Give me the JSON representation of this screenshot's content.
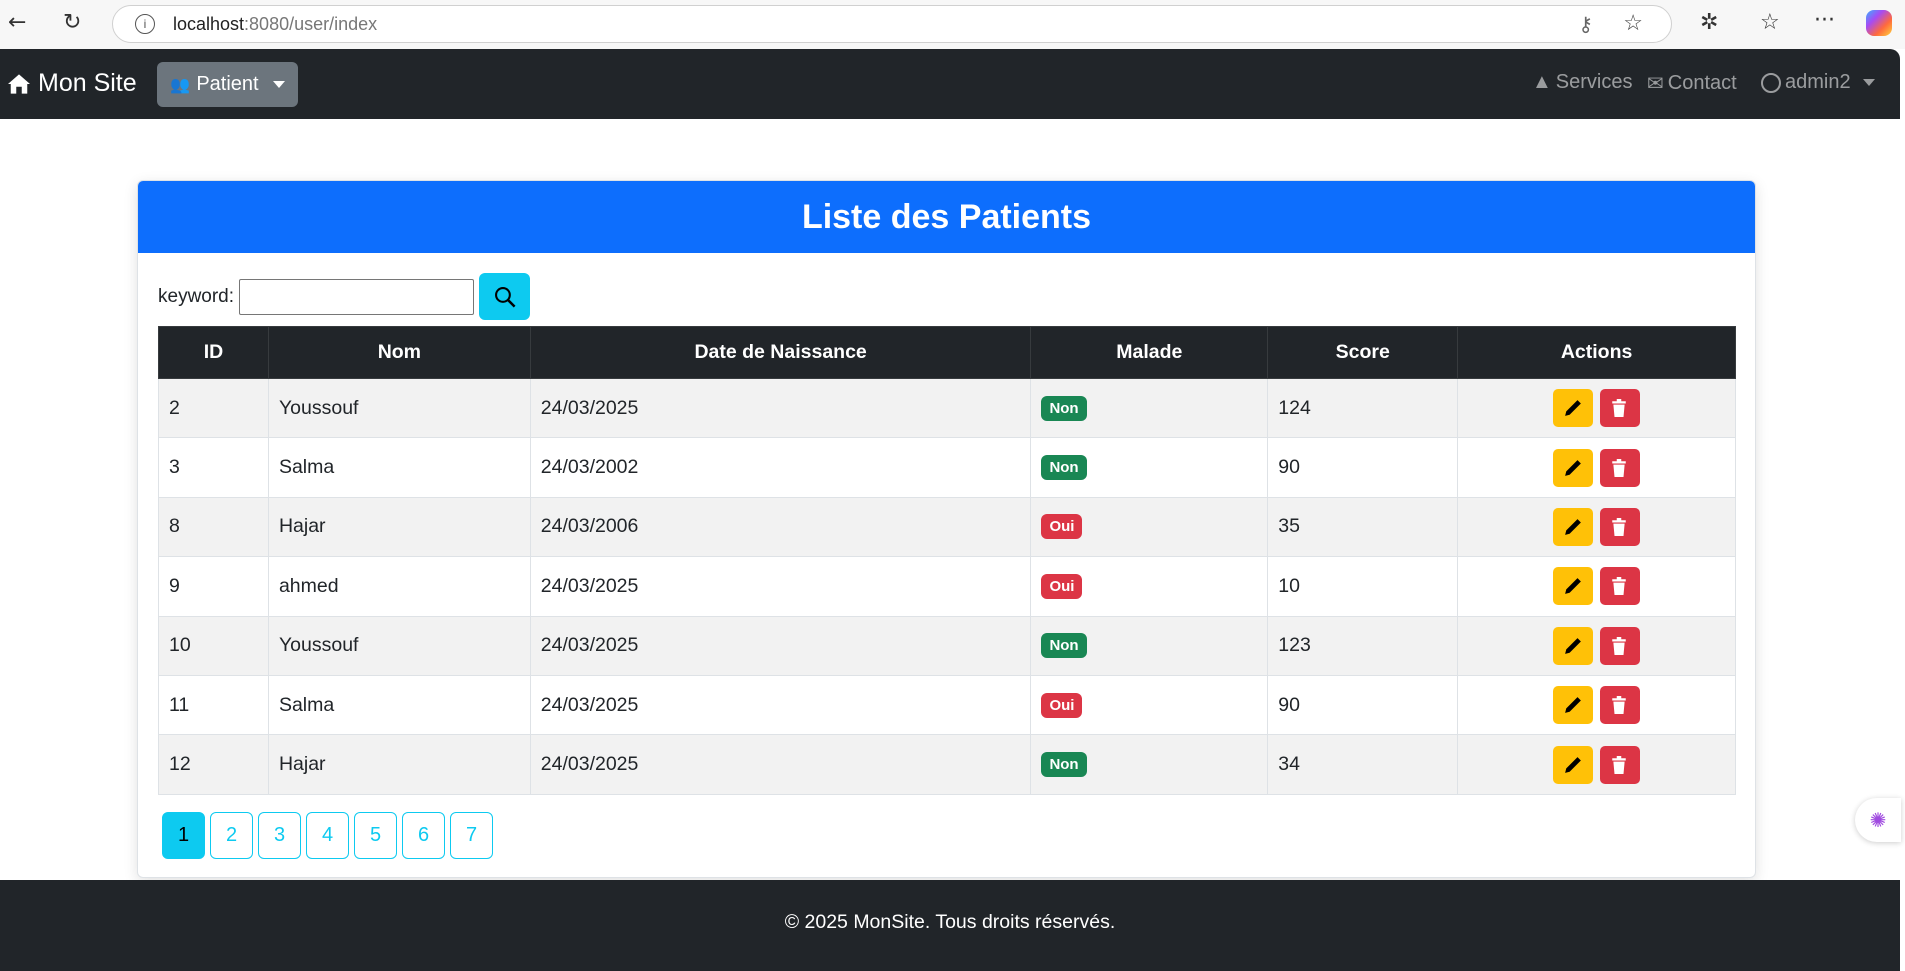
{
  "browser": {
    "url_host": "localhost",
    "url_rest": ":8080/user/index"
  },
  "navbar": {
    "brand": "Mon Site",
    "patient_menu": "Patient",
    "services": "Services",
    "contact": "Contact",
    "user": "admin2"
  },
  "card": {
    "title": "Liste des Patients"
  },
  "search": {
    "label": "keyword:",
    "value": "",
    "placeholder": ""
  },
  "table": {
    "headers": [
      "ID",
      "Nom",
      "Date de Naissance",
      "Malade",
      "Score",
      "Actions"
    ],
    "rows": [
      {
        "id": "2",
        "nom": "Youssouf",
        "date": "24/03/2025",
        "malade": "Non",
        "score": "124"
      },
      {
        "id": "3",
        "nom": "Salma",
        "date": "24/03/2002",
        "malade": "Non",
        "score": "90"
      },
      {
        "id": "8",
        "nom": "Hajar",
        "date": "24/03/2006",
        "malade": "Oui",
        "score": "35"
      },
      {
        "id": "9",
        "nom": "ahmed",
        "date": "24/03/2025",
        "malade": "Oui",
        "score": "10"
      },
      {
        "id": "10",
        "nom": "Youssouf",
        "date": "24/03/2025",
        "malade": "Non",
        "score": "123"
      },
      {
        "id": "11",
        "nom": "Salma",
        "date": "24/03/2025",
        "malade": "Oui",
        "score": "90"
      },
      {
        "id": "12",
        "nom": "Hajar",
        "date": "24/03/2025",
        "malade": "Non",
        "score": "34"
      }
    ]
  },
  "pagination": {
    "pages": [
      "1",
      "2",
      "3",
      "4",
      "5",
      "6",
      "7"
    ],
    "current": "1"
  },
  "footer": {
    "text": "© 2025 MonSite. Tous droits réservés."
  },
  "colors": {
    "primary": "#0d6efd",
    "info": "#0dcaf0",
    "success": "#198754",
    "danger": "#dc3545",
    "warning": "#ffc107",
    "dark": "#212529"
  }
}
